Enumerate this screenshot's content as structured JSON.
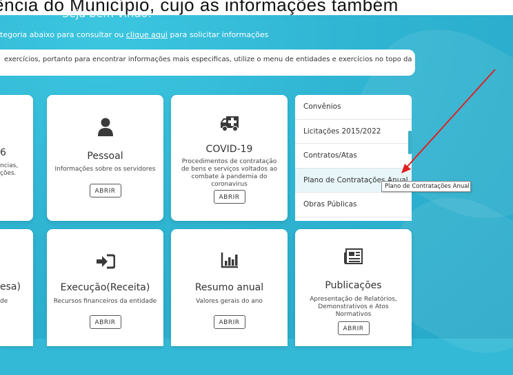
{
  "header": {
    "top_text": "rência do Município, cujo as informações também",
    "welcome": "Seja bem-vindo!",
    "subtitle_before": "tegoria abaixo para consultar ou ",
    "subtitle_link": "clique aqui",
    "subtitle_after": " para solicitar informações",
    "info": "exercícios, portanto para encontrar informações mais especificas, utilize o menu de entidades e exercícios no topo da"
  },
  "row1": {
    "partial": {
      "line1": "6",
      "line2": "ncias,",
      "line3": "ções."
    },
    "pessoal": {
      "icon": "person-icon",
      "title": "Pessoal",
      "desc": "Informações sobre os servidores",
      "button": "ABRIR"
    },
    "covid": {
      "icon": "ambulance-icon",
      "title": "COVID-19",
      "desc": "Procedimentos de contratação de bens e serviços voltados ao combate à pandemia do coronavirus",
      "button": "ABRIR"
    }
  },
  "menu": {
    "items": [
      "Convênios",
      "Licitações 2015/2022",
      "Contratos/Atas",
      "Plano de Contratações Anual",
      "Obras Públicas"
    ],
    "tooltip": "Plano de Contratações Anual"
  },
  "row2": {
    "partial": {
      "title": "esa)",
      "desc": "de"
    },
    "execucao": {
      "icon": "sign-in-icon",
      "title": "Execução(Receita)",
      "desc": "Recursos financeiros da entidade",
      "button": "ABRIR"
    },
    "resumo": {
      "icon": "bar-chart-icon",
      "title": "Resumo anual",
      "desc": "Valores gerais do ano",
      "button": "ABRIR"
    },
    "publicacoes": {
      "icon": "newspaper-icon",
      "title": "Publicações",
      "desc": "Apresentação de Relatórios, Demonstrativos e Atos Normativos",
      "button": "ABRIR"
    }
  },
  "colors": {
    "background": "#33b9d6",
    "arrow": "#e02020"
  }
}
